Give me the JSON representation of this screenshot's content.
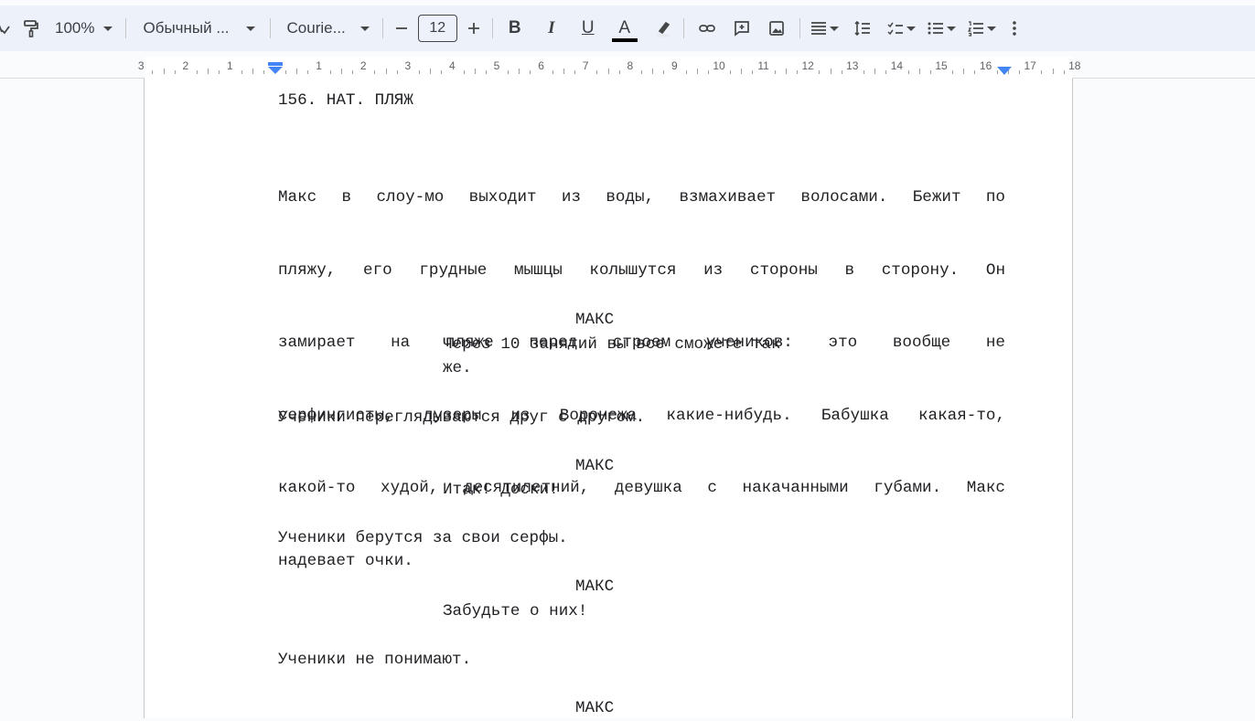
{
  "toolbar": {
    "zoom": "100%",
    "style": "Обычный ...",
    "font": "Courie...",
    "font_size": "12",
    "bold": "B",
    "italic": "I",
    "underline": "U",
    "text_color": "A",
    "text_color_value": "#000000"
  },
  "ruler": {
    "numbers": [
      "3",
      "2",
      "1",
      "1",
      "2",
      "3",
      "4",
      "5",
      "6",
      "7",
      "8",
      "9",
      "10",
      "11",
      "12",
      "13",
      "14",
      "15",
      "16",
      "17",
      "18"
    ],
    "marker_color": "#4285f4"
  },
  "script": {
    "scene_heading": "156. НАТ. ПЛЯЖ",
    "action1": [
      "Макс в слоу-мо выходит из воды, взмахивает волосами. Бежит по",
      "пляжу, его грудные мышцы колышутся из стороны в сторону. Он",
      "замирает на пляже перед строем учеников: это вообще не",
      "серфингисты, лузеры из Воронежа какие-нибудь. Бабушка какая-то,",
      "какой-то худой, десятилетний, девушка с накачанными губами. Макс",
      "надевает очки."
    ],
    "char1": "МАКС",
    "dial1": [
      "Через 10 занятий вы все сможете так",
      "же."
    ],
    "action2": "Ученики переглядываются друг с другом.",
    "char2": "МАКС",
    "dial2": "Итак! Доски!",
    "action3": "Ученики берутся за свои серфы.",
    "char3": "МАКС",
    "dial3": "Забудьте о них!",
    "action4": "Ученики не понимают.",
    "char4": "МАКС"
  }
}
